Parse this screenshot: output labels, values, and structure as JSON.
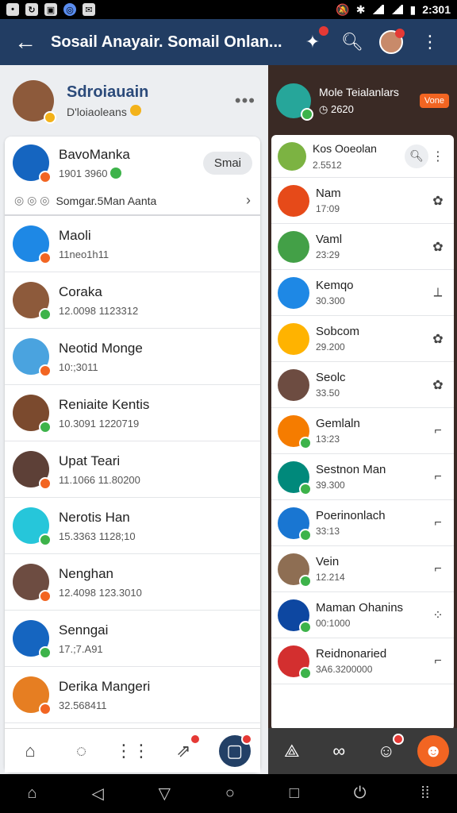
{
  "status_bar": {
    "time": "2:301"
  },
  "app_bar": {
    "title": "Sosail Anayair. Somail Onlan...",
    "back_icon": "arrow-left-icon",
    "actions": [
      "puzzle-icon",
      "search-icon",
      "avatar"
    ]
  },
  "left": {
    "header": {
      "name": "Sdroiauain",
      "sub": "D'loiaoleans"
    },
    "featured": {
      "name": "BavoManka",
      "meta": "1901 3960",
      "button": "Smai",
      "link": "Somgar.5Man Aanta"
    },
    "items": [
      {
        "name": "Maoli",
        "meta": "11neo1h11",
        "color": "#1e88e5"
      },
      {
        "name": "Coraka",
        "meta": "12.0098 1123312",
        "color": "#8d5a3b"
      },
      {
        "name": "Neotid Monge",
        "meta": "10:;3011",
        "color": "#4aa3df"
      },
      {
        "name": "Reniaite Kentis",
        "meta": "10.3091 1220719",
        "color": "#7b4a2e"
      },
      {
        "name": "Upat Teari",
        "meta": "11.1066 11.80200",
        "color": "#5d4037"
      },
      {
        "name": "Nerotis Han",
        "meta": "15.3363 1128;10",
        "color": "#26c6da"
      },
      {
        "name": "Nenghan",
        "meta": "12.4098 123.3010",
        "color": "#6d4c41"
      },
      {
        "name": "Senngai",
        "meta": "17.;7.A91",
        "color": "#1565c0"
      },
      {
        "name": "Derika Mangeri",
        "meta": "32.568411",
        "color": "#e67e22"
      }
    ],
    "tabs": [
      "home-icon",
      "chat-icon",
      "grid-icon",
      "share-icon",
      "bag-icon"
    ]
  },
  "right": {
    "header": {
      "name": "Mole Teialanlars",
      "sub": "2620",
      "tag": "Vone"
    },
    "top": {
      "name": "Kos Ooeolan",
      "meta": "2.5512"
    },
    "items": [
      {
        "name": "Nam",
        "meta": "17:09",
        "color": "#e64a19"
      },
      {
        "name": "Vaml",
        "meta": "23:29",
        "color": "#43a047"
      },
      {
        "name": "Kemqo",
        "meta": "30.300",
        "color": "#1e88e5"
      },
      {
        "name": "Sobcom",
        "meta": "29.200",
        "color": "#ffb300"
      },
      {
        "name": "Seolc",
        "meta": "33.50",
        "color": "#6d4c41"
      },
      {
        "name": "Gemlaln",
        "meta": "13:23",
        "color": "#f57c00"
      },
      {
        "name": "Sestnon Man",
        "meta": "39.300",
        "color": "#00897b"
      },
      {
        "name": "Poerinonlach",
        "meta": "33:13",
        "color": "#1976d2"
      },
      {
        "name": "Vein",
        "meta": "12.214",
        "color": "#8e6e53"
      },
      {
        "name": "Maman Ohanins",
        "meta": "00:1000",
        "color": "#0d47a1"
      },
      {
        "name": "Reidnonaried",
        "meta": "3A6.3200000",
        "color": "#d32f2f"
      }
    ],
    "tabs": [
      "network-icon",
      "loop-icon",
      "chat-bubble-icon",
      "smile-icon"
    ]
  }
}
